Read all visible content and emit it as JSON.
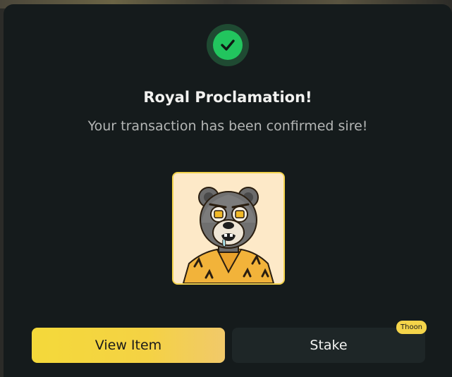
{
  "modal": {
    "title": "Royal Proclamation!",
    "subtitle": "Your transaction has been confirmed sire!",
    "status_icon": "check-circle-icon",
    "nft_image": "bear-nft-avatar"
  },
  "actions": {
    "view_item_label": "View Item",
    "stake_label": "Stake",
    "stake_badge": "Thoon"
  },
  "colors": {
    "modal_bg": "#151b1c",
    "success": "#22c55e",
    "accent_yellow": "#f4d93a",
    "secondary_button": "#1e2627"
  }
}
